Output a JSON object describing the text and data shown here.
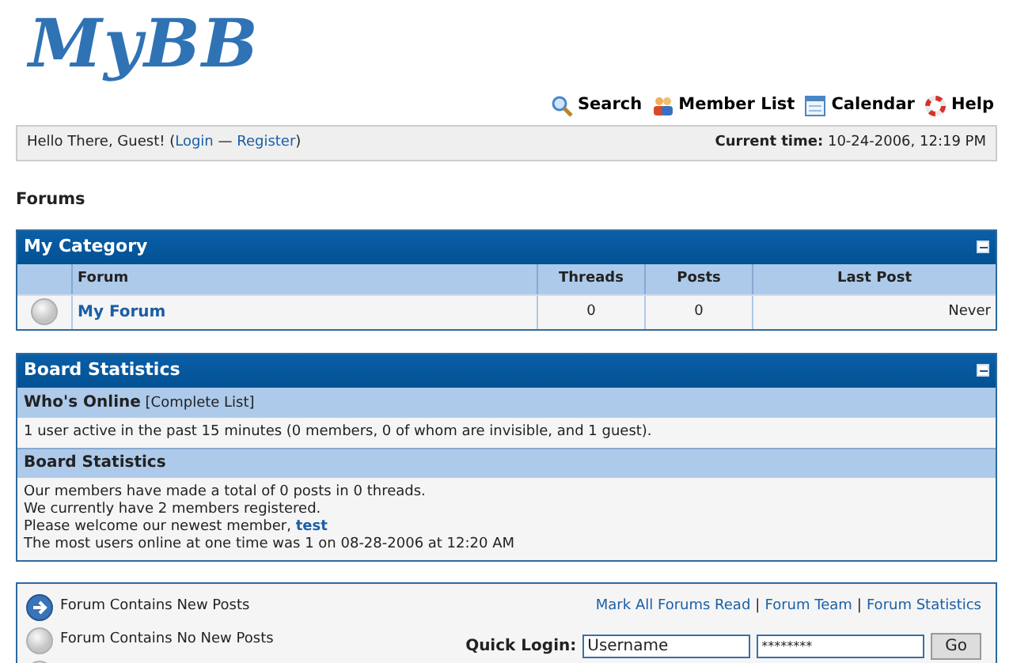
{
  "logo": {
    "text": "MyBB"
  },
  "nav": [
    {
      "label": "Search"
    },
    {
      "label": "Member List"
    },
    {
      "label": "Calendar"
    },
    {
      "label": "Help"
    }
  ],
  "welcome": {
    "greeting": "Hello There, Guest! (",
    "login": "Login",
    "separator": " — ",
    "register": "Register",
    "close": ")",
    "time_label": "Current time:",
    "time_value": "10-24-2006, 12:19 PM"
  },
  "page_title": "Forums",
  "category": {
    "title": "My Category",
    "columns": [
      "Forum",
      "Threads",
      "Posts",
      "Last Post"
    ],
    "rows": [
      {
        "new_posts": false,
        "forum": "My Forum",
        "threads": "0",
        "posts": "0",
        "last_post": "Never"
      }
    ]
  },
  "board_statistics": {
    "title": "Board Statistics",
    "whos_online": {
      "heading": "Who's Online",
      "link": "[Complete List]",
      "text": "1 user active in the past 15 minutes (0 members, 0 of whom are invisible, and 1 guest)."
    },
    "stats": {
      "heading": "Board Statistics",
      "lines": [
        "Our members have made a total of 0 posts in 0 threads.",
        "We currently have 2 members registered."
      ],
      "newest_prefix": "Please welcome our newest member, ",
      "newest_member": "test",
      "record": "The most users online at one time was 1 on 08-28-2006 at 12:20 AM"
    }
  },
  "legend": [
    {
      "kind": "new",
      "label": "Forum Contains New Posts"
    },
    {
      "kind": "nonew",
      "label": "Forum Contains No New Posts"
    },
    {
      "kind": "locked"
    }
  ],
  "footer_links": [
    "Mark All Forums Read",
    "Forum Team",
    "Forum Statistics"
  ],
  "footer_separator": "|",
  "quick_login": {
    "label": "Quick Login:",
    "username": "Username",
    "password": "********",
    "button": "Go"
  }
}
